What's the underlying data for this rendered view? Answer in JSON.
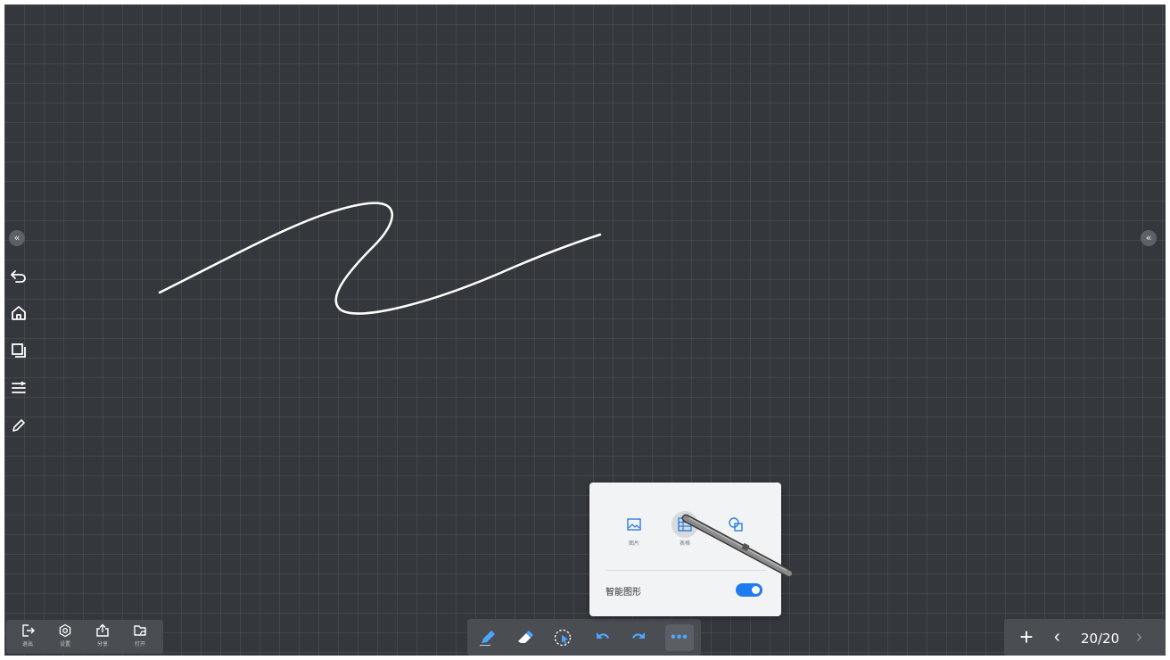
{
  "canvas": {
    "background": "#34373c",
    "grid": true,
    "stroke_color": "#ffffff"
  },
  "collapse": {
    "left_icon": "double-chevron-left-icon",
    "right_icon": "double-chevron-left-icon",
    "glyph": "«"
  },
  "left_tools": [
    {
      "name": "undo",
      "icon": "undo-icon"
    },
    {
      "name": "home",
      "icon": "home-icon"
    },
    {
      "name": "pages",
      "icon": "pages-icon"
    },
    {
      "name": "menu",
      "icon": "menu-lines-icon"
    },
    {
      "name": "pen",
      "icon": "pencil-icon"
    }
  ],
  "bottom_left": {
    "items": [
      {
        "label": "退出",
        "icon": "exit-icon"
      },
      {
        "label": "设置",
        "icon": "settings-icon"
      },
      {
        "label": "分享",
        "icon": "share-icon"
      },
      {
        "label": "打开",
        "icon": "open-folder-icon"
      }
    ]
  },
  "bottom_center": {
    "items": [
      {
        "icon": "pen-icon"
      },
      {
        "icon": "eraser-icon"
      },
      {
        "icon": "lasso-select-icon"
      },
      {
        "icon": "undo-icon"
      },
      {
        "icon": "redo-icon"
      },
      {
        "icon": "more-icon",
        "label": "•••"
      }
    ],
    "accent": "#4ea5ff"
  },
  "bottom_right": {
    "add": "+",
    "prev": "‹",
    "page": "20/20",
    "next": "›"
  },
  "popup": {
    "items": [
      {
        "label": "图片",
        "icon": "image-icon"
      },
      {
        "label": "表格",
        "icon": "table-icon",
        "active": true
      },
      {
        "label": "",
        "icon": "shapes-icon"
      }
    ],
    "smart_shape_label": "智能图形",
    "smart_shape_enabled": true,
    "toggle_color": "#1f7bf0"
  }
}
